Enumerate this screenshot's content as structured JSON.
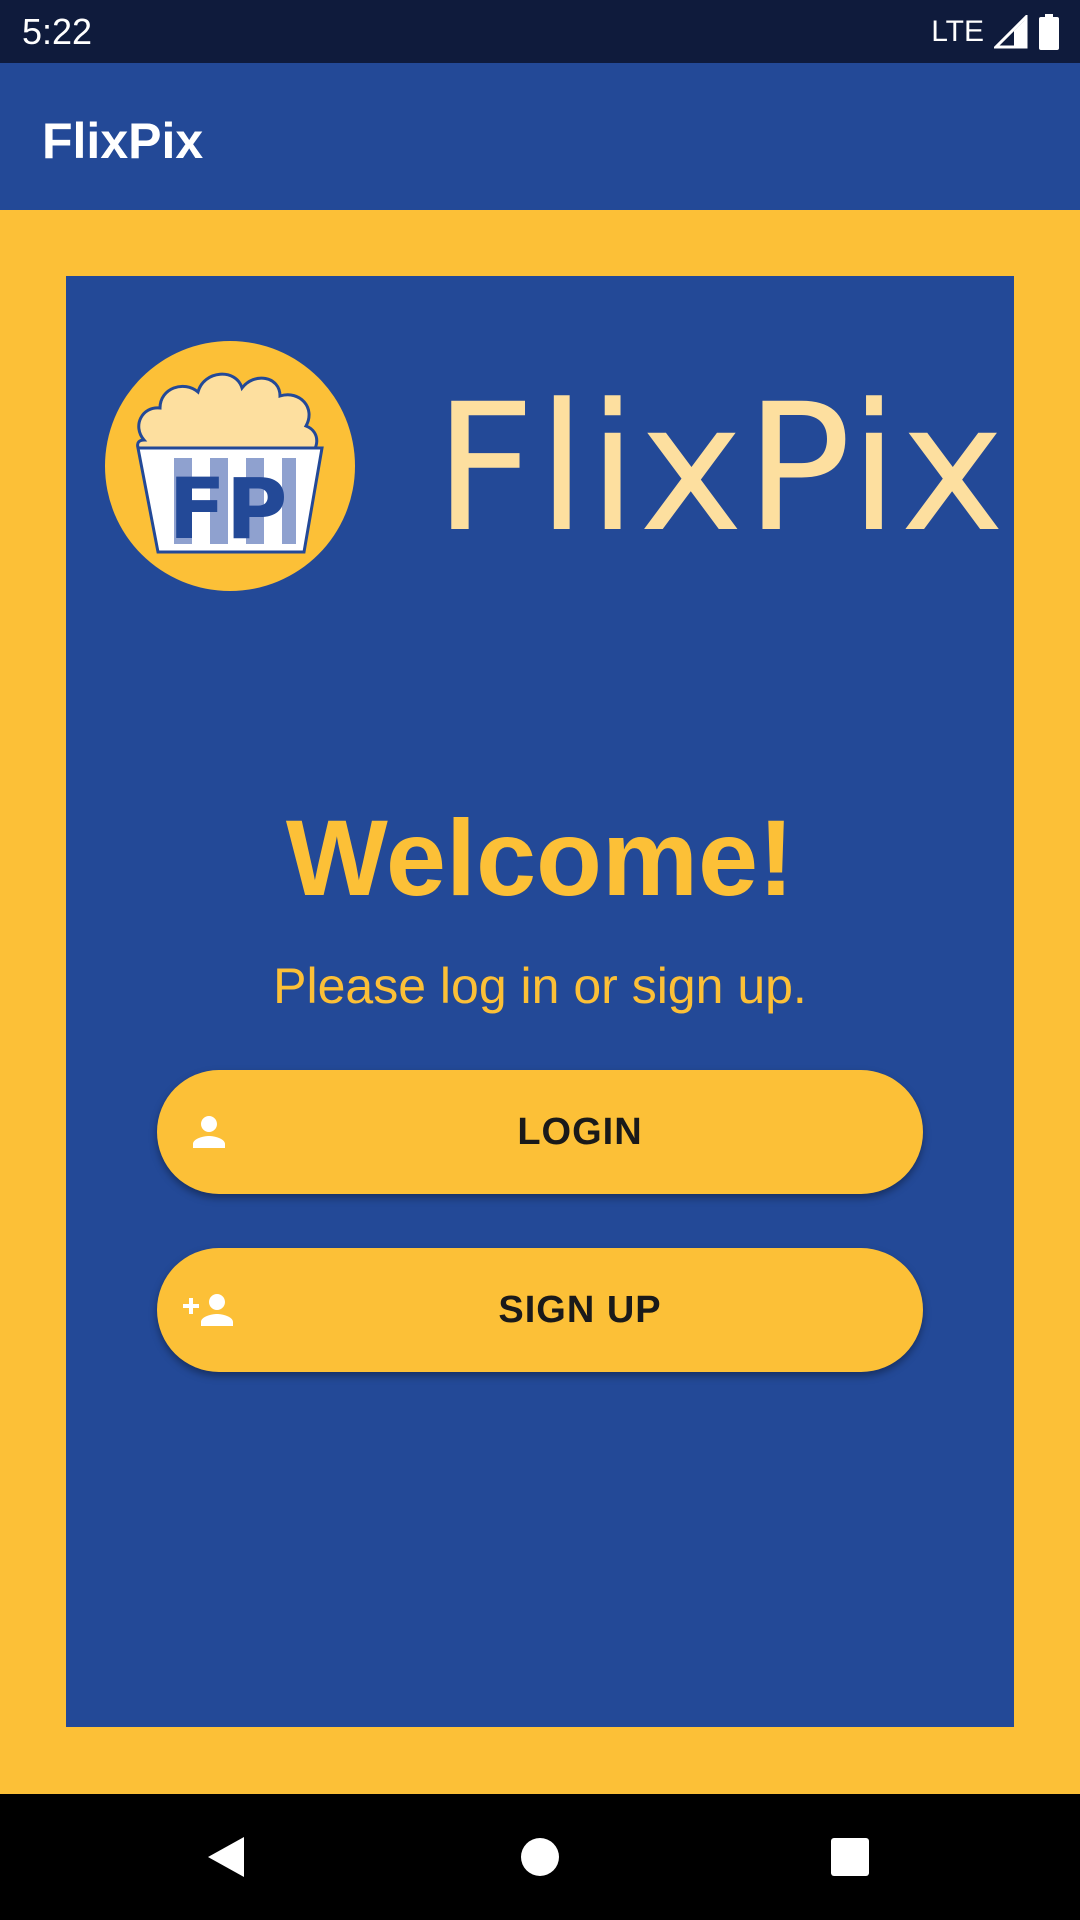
{
  "status_bar": {
    "time": "5:22",
    "network": "LTE",
    "icons": [
      "signal-icon",
      "battery-icon"
    ]
  },
  "app_bar": {
    "title": "FlixPix"
  },
  "logo": {
    "wordmark": "FlixPix",
    "badge_letters": "FP",
    "icon": "popcorn-bucket-icon"
  },
  "welcome": {
    "heading": "Welcome!",
    "subtitle": "Please log in or sign up."
  },
  "buttons": {
    "login": {
      "label": "LOGIN",
      "icon": "person-icon"
    },
    "signup": {
      "label": "SIGN UP",
      "icon": "person-add-icon"
    }
  },
  "nav": {
    "icons": [
      "back-icon",
      "home-icon",
      "recents-icon"
    ]
  },
  "colors": {
    "primary": "#234997",
    "accent": "#FCC037",
    "status_bar": "#0F1B3C",
    "wordmark": "#FDDF9F"
  }
}
